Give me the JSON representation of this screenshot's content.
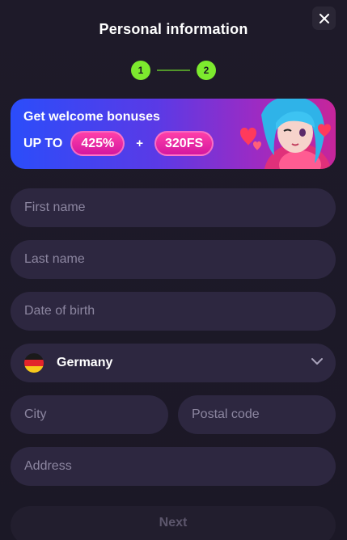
{
  "header": {
    "title": "Personal information"
  },
  "stepper": {
    "steps": [
      "1",
      "2"
    ],
    "current": 2
  },
  "banner": {
    "title": "Get welcome bonuses",
    "upto": "UP TO",
    "bonus_percent": "425%",
    "plus": "+",
    "bonus_fs": "320FS"
  },
  "form": {
    "first_name_placeholder": "First name",
    "last_name_placeholder": "Last name",
    "dob_placeholder": "Date of birth",
    "country_value": "Germany",
    "city_placeholder": "City",
    "postal_placeholder": "Postal code",
    "address_placeholder": "Address"
  },
  "footer": {
    "next_label": "Next"
  },
  "icons": {
    "close": "close-icon",
    "chevron": "chevron-down-icon",
    "flag": "germany-flag-icon"
  },
  "colors": {
    "accent_green": "#7dea2e",
    "field_bg": "#2d2740",
    "pill_pink": "#e0209f"
  }
}
